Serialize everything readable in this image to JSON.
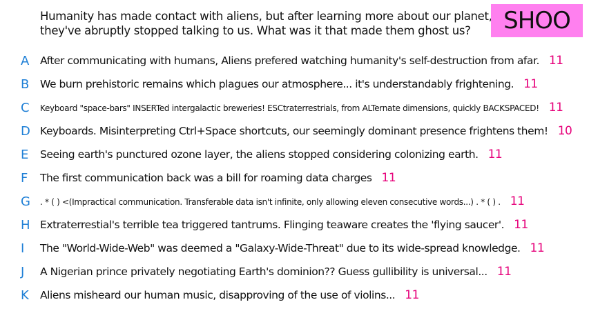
{
  "prompt": {
    "line1": "Humanity has made contact with aliens, but after learning more about our planet,",
    "line2": "they've abruptly stopped talking to us. What was it that made them ghost us?"
  },
  "badge": {
    "label": "SHOO",
    "color": "#ff80ef"
  },
  "colors": {
    "letter": "#1e7fd6",
    "count": "#e6007a",
    "text": "#111111"
  },
  "answers": [
    {
      "letter": "A",
      "text": "After communicating with humans, Aliens prefered watching humanity's self-destruction from afar.",
      "count": "11"
    },
    {
      "letter": "B",
      "text": "We burn prehistoric remains which plagues our atmosphere... it's understandably frightening.",
      "count": "11"
    },
    {
      "letter": "C",
      "text": "Keyboard \"space-bars\" INSERTed intergalactic breweries! ESCtraterrestrials, from ALTernate dimensions, quickly BACKSPACED!",
      "count": "11"
    },
    {
      "letter": "D",
      "text": "Keyboards. Misinterpreting Ctrl+Space shortcuts, our seemingly dominant presence frightens them!",
      "count": "10"
    },
    {
      "letter": "E",
      "text": "Seeing earth's punctured ozone layer, the aliens stopped considering colonizing earth.",
      "count": "11"
    },
    {
      "letter": "F",
      "text": "The first communication back was a bill for roaming data charges",
      "count": "11"
    },
    {
      "letter": "G",
      "text": ". * ( ) <(Impractical communication. Transferable data isn't infinite, only allowing eleven consecutive words...)   .  * ( ) .",
      "count": "11"
    },
    {
      "letter": "H",
      "text": "Extraterrestial's terrible tea triggered tantrums. Flinging teaware creates the 'flying saucer'.",
      "count": "11"
    },
    {
      "letter": "I",
      "text": "The \"World-Wide-Web\" was deemed a \"Galaxy-Wide-Threat\" due to its wide-spread knowledge.",
      "count": "11"
    },
    {
      "letter": "J",
      "text": "A Nigerian prince privately negotiating Earth's dominion?? Guess gullibility is universal...",
      "count": "11"
    },
    {
      "letter": "K",
      "text": "Aliens misheard our human music, disapproving of the use of violins...",
      "count": "11"
    }
  ]
}
